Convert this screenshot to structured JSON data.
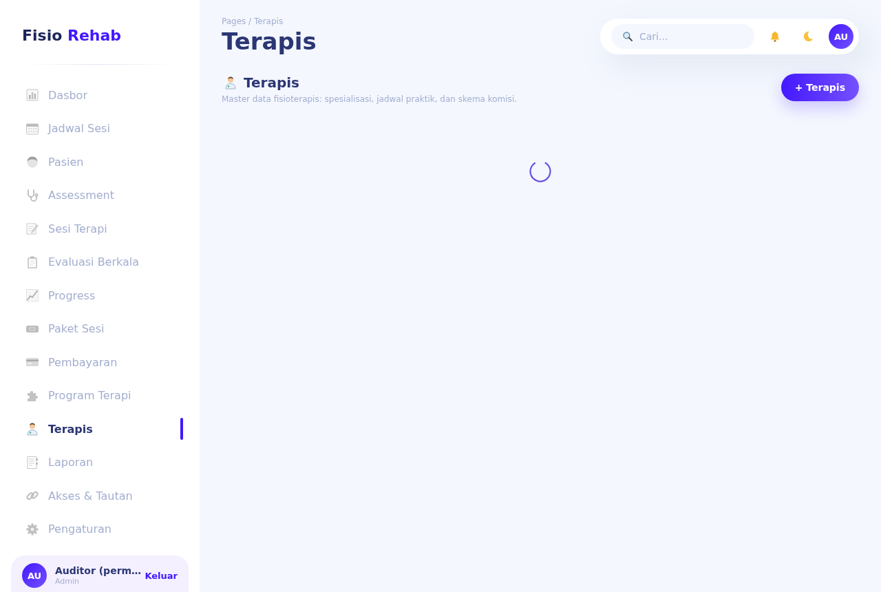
{
  "sidebar": {
    "brand": {
      "name": "Fisio",
      "accent": "Rehab"
    },
    "items": [
      {
        "label": "Dasbor",
        "selected": false
      },
      {
        "label": "Jadwal Sesi",
        "selected": false
      },
      {
        "label": "Pasien",
        "selected": false
      },
      {
        "label": "Assessment",
        "selected": false
      },
      {
        "label": "Sesi Terapi",
        "selected": false
      },
      {
        "label": "Evaluasi Berkala",
        "selected": false
      },
      {
        "label": "Progress",
        "selected": false
      },
      {
        "label": "Paket Sesi",
        "selected": false
      },
      {
        "label": "Pembayaran",
        "selected": false
      },
      {
        "label": "Program Terapi",
        "selected": false
      },
      {
        "label": "Terapis",
        "selected": true
      },
      {
        "label": "Laporan",
        "selected": false
      },
      {
        "label": "Akses & Tautan",
        "selected": false
      },
      {
        "label": "Pengaturan",
        "selected": false
      }
    ],
    "user": {
      "avatar": "AU",
      "name": "Auditor (perm…",
      "role": "Admin",
      "logout": "Keluar"
    }
  },
  "header": {
    "breadcrumb": "Pages / Terapis",
    "title": "Terapis",
    "search": {
      "placeholder": "Cari..."
    },
    "avatar": "AU"
  },
  "section": {
    "title": "Terapis",
    "description": "Master data fisioterapis: spesialisasi, jadwal praktik, dan skema komisi.",
    "add_button": "+ Terapis",
    "loading": true
  }
}
